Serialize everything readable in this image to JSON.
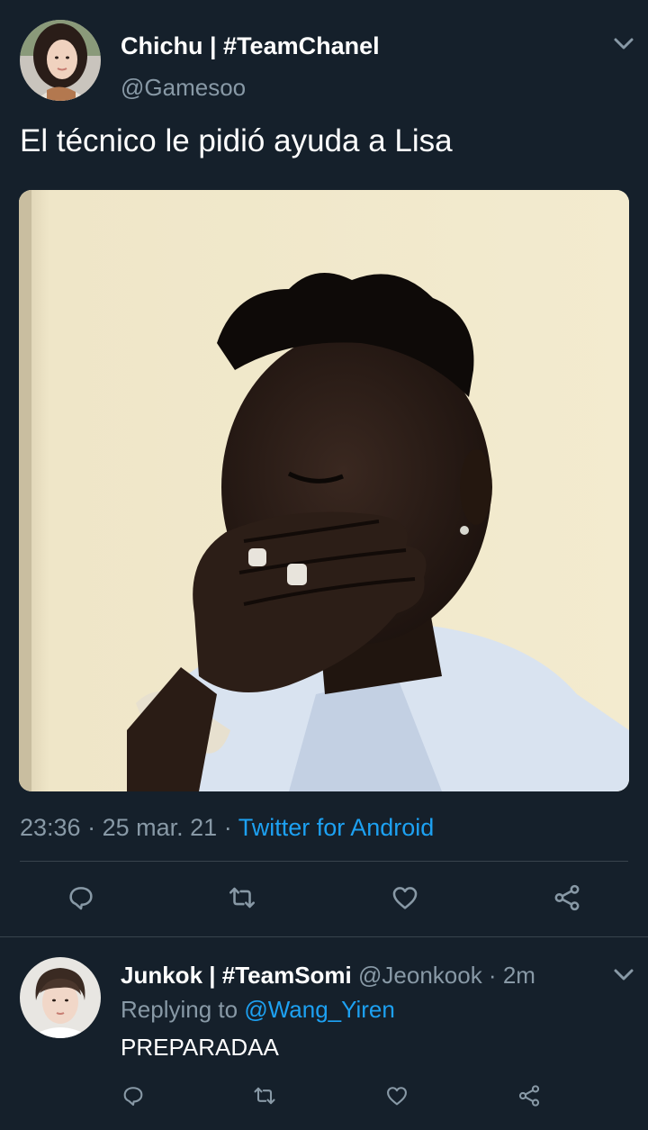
{
  "tweet": {
    "author_name": "Chichu | #TeamChanel",
    "author_handle": "@Gamesoo",
    "text": "El técnico le pidió ayuda a Lisa",
    "time": "23:36",
    "date": "25 mar. 21",
    "source": "Twitter for Android",
    "avatar_icon": "profile-photo",
    "media_icon": "photo-man-covering-mouth"
  },
  "reply": {
    "author_name": "Junkok | #TeamSomi",
    "author_handle": "@Jeonkook",
    "time_ago": "2m",
    "replying_label": "Replying to",
    "replying_to": "@Wang_Yiren",
    "text": "PREPARADAA",
    "avatar_icon": "profile-photo"
  },
  "actions": [
    "reply-icon",
    "retweet-icon",
    "like-icon",
    "share-icon"
  ],
  "colors": {
    "background": "#15202b",
    "text": "#ffffff",
    "secondary": "#8899a6",
    "accent": "#1da1f2",
    "divider": "#38444d"
  }
}
